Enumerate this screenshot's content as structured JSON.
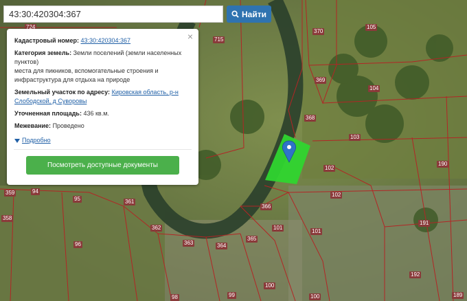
{
  "search": {
    "value": "43:30:420304:367",
    "button_label": "Найти"
  },
  "card": {
    "cadastral_label": "Кадастровый номер:",
    "cadastral_value": "43:30:420304:367",
    "category_label": "Категория земель:",
    "category_value": "Земли поселений (земли населенных пунктов)",
    "category_desc": "места для пикников, вспомогательные строения и инфраструктура для отдыха на природе",
    "address_label": "Земельный участок по адресу:",
    "address_value": "Кировская область, р-н Слободской, д Суворовы",
    "area_label": "Уточненная площадь:",
    "area_value": "436 кв.м.",
    "survey_label": "Межевание:",
    "survey_value": "Проведено",
    "more_label": "Подробно",
    "docs_button": "Посмотреть доступные документы",
    "close_symbol": "×"
  },
  "map": {
    "parcel_labels": [
      {
        "text": "724"
      },
      {
        "text": "715"
      },
      {
        "text": "370"
      },
      {
        "text": "105"
      },
      {
        "text": "369"
      },
      {
        "text": "104"
      },
      {
        "text": "368"
      },
      {
        "text": "103"
      },
      {
        "text": "102"
      },
      {
        "text": "190"
      },
      {
        "text": "102"
      },
      {
        "text": "366"
      },
      {
        "text": "101"
      },
      {
        "text": "101"
      },
      {
        "text": "191"
      },
      {
        "text": "359"
      },
      {
        "text": "94"
      },
      {
        "text": "95"
      },
      {
        "text": "361"
      },
      {
        "text": "358"
      },
      {
        "text": "362"
      },
      {
        "text": "96"
      },
      {
        "text": "363"
      },
      {
        "text": "364"
      },
      {
        "text": "365"
      },
      {
        "text": "192"
      },
      {
        "text": "100"
      },
      {
        "text": "98"
      },
      {
        "text": "99"
      },
      {
        "text": "100"
      },
      {
        "text": "189"
      }
    ],
    "selected_parcel_color": "#2fd52f",
    "marker_color": "#2f73c8",
    "icon": "map-pin-icon"
  }
}
